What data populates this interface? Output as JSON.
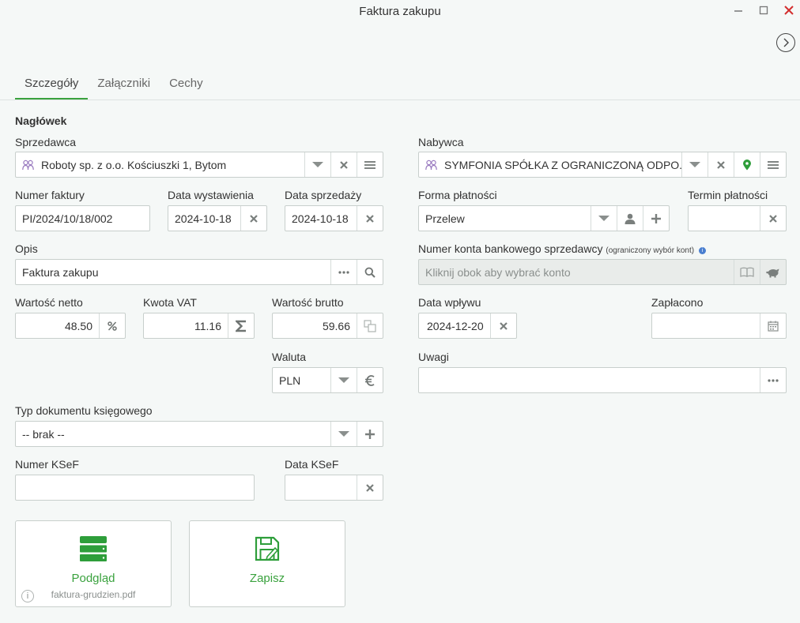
{
  "window": {
    "title": "Faktura zakupu"
  },
  "tabs": [
    {
      "label": "Szczegóły"
    },
    {
      "label": "Załączniki"
    },
    {
      "label": "Cechy"
    }
  ],
  "section": {
    "header": "Nagłówek"
  },
  "seller": {
    "label": "Sprzedawca",
    "value": "Roboty sp. z o.o. Kościuszki 1, Bytom"
  },
  "buyer": {
    "label": "Nabywca",
    "value": "SYMFONIA SPÓŁKA Z OGRANICZONĄ ODPO..."
  },
  "invoice_number": {
    "label": "Numer faktury",
    "value": "PI/2024/10/18/002"
  },
  "issue_date": {
    "label": "Data wystawienia",
    "value": "2024-10-18"
  },
  "sale_date": {
    "label": "Data sprzedaży",
    "value": "2024-10-18"
  },
  "payment_form": {
    "label": "Forma płatności",
    "value": "Przelew"
  },
  "payment_term": {
    "label": "Termin płatności",
    "value": ""
  },
  "description": {
    "label": "Opis",
    "value": "Faktura zakupu"
  },
  "bank_account": {
    "label": "Numer konta bankowego sprzedawcy",
    "note": "(ograniczony wybór kont)",
    "info": "i",
    "placeholder": "Kliknij obok aby wybrać konto"
  },
  "net": {
    "label": "Wartość netto",
    "value": "48.50"
  },
  "vat": {
    "label": "Kwota VAT",
    "value": "11.16"
  },
  "gross": {
    "label": "Wartość brutto",
    "value": "59.66"
  },
  "receipt_date": {
    "label": "Data wpływu",
    "value": "2024-12-20"
  },
  "paid": {
    "label": "Zapłacono",
    "value": ""
  },
  "currency": {
    "label": "Waluta",
    "value": "PLN"
  },
  "notes": {
    "label": "Uwagi",
    "value": ""
  },
  "doc_type": {
    "label": "Typ dokumentu księgowego",
    "value": "-- brak --"
  },
  "ksef_number": {
    "label": "Numer KSeF",
    "value": ""
  },
  "ksef_date": {
    "label": "Data KSeF",
    "value": ""
  },
  "preview": {
    "label": "Podgląd",
    "file": "faktura-grudzien.pdf",
    "info": "i"
  },
  "save": {
    "label": "Zapisz"
  },
  "colors": {
    "accent": "#3aa23e",
    "close": "#d32f2f",
    "location": "#2e9e3a"
  }
}
